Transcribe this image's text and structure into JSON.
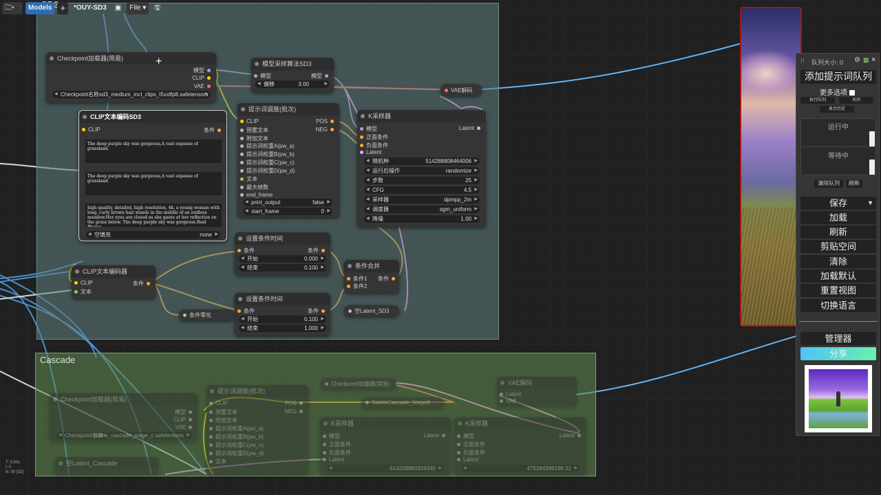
{
  "topbar": {
    "folder_icon": "folder-icon",
    "models_label": "Models",
    "add_label": "+",
    "title": "*OUY-SD3",
    "file_label": "File"
  },
  "groups": {
    "sd3": "SD3",
    "cascade": "Cascade"
  },
  "nodes": {
    "ckpt": {
      "title": "Checkpoint加载器(简易)",
      "out1": "模型",
      "out2": "CLIP",
      "out3": "VAE",
      "w_key": "Checkpoint名称",
      "w_val": "sd3_medium_incl_clips_t5xxlfp8.safetensors"
    },
    "sampling": {
      "title": "模型采样算法SD3",
      "in1": "模型",
      "out1": "模型",
      "w_key": "偏移",
      "w_val": "3.00"
    },
    "vae_decode": {
      "title": "VAE解码"
    },
    "clip_sd3": {
      "title": "CLIP文本编码SD3",
      "in1": "CLIP",
      "out1": "条件",
      "t1": "The deep purple sky was gorgeous,A vast expanse of grassland.",
      "t2": "The deep purple sky was gorgeous,A vast expanse of grassland.",
      "t3": "high quality, detailed, high resolution, 4k,\na young woman with long, curly brown hair stands in the middle of an endless meadow.Her eyes are closed as she gazes at her reflection on the grass below. The deep purple sky was gorgeous.Real Photos.",
      "w_key": "空填充",
      "w_val": "none"
    },
    "prompt_batch": {
      "title": "提示词调度(批次)",
      "in1": "CLIP",
      "in2": "预置文本",
      "in3": "附加文本",
      "in4": "提示词权重A(pw_a)",
      "in5": "提示词权重B(pw_b)",
      "in6": "提示词权重C(pw_c)",
      "in7": "提示词权重D(pw_d)",
      "in8": "文本",
      "in9": "最大帧数",
      "in10": "end_frame",
      "out1": "POS",
      "out2": "NEG",
      "w1_key": "print_output",
      "w1_val": "false",
      "w2_key": "start_frame",
      "w2_val": "0"
    },
    "ksampler": {
      "title": "K采样器",
      "in1": "模型",
      "in2": "正面条件",
      "in3": "负面条件",
      "in4": "Latent",
      "out1": "Latent",
      "w": [
        [
          "随机种",
          "514288808464006"
        ],
        [
          "运行后操作",
          "randomize"
        ],
        [
          "步数",
          "25"
        ],
        [
          "CFG",
          "4.5"
        ],
        [
          "采样器",
          "dpmpp_2m"
        ],
        [
          "调度器",
          "sgm_uniform"
        ],
        [
          "降噪",
          "1.00"
        ]
      ]
    },
    "clip_enc": {
      "title": "CLIP文本编码器",
      "in1": "CLIP",
      "in2": "文本",
      "out1": "条件"
    },
    "cond_time1": {
      "title": "设置条件时间",
      "in1": "条件",
      "out1": "条件",
      "w1_key": "开始",
      "w1_val": "0.000",
      "w2_key": "结束",
      "w2_val": "0.100"
    },
    "cond_time2": {
      "title": "设置条件时间",
      "in1": "条件",
      "out1": "条件",
      "w1_key": "开始",
      "w1_val": "0.100",
      "w2_key": "结束",
      "w2_val": "1.000"
    },
    "cond_combine": {
      "title": "条件合并",
      "in1": "条件1",
      "in2": "条件2",
      "out1": "条件"
    },
    "cond_zero": {
      "title": "条件零化"
    },
    "empty_latent": {
      "title": "空Latent_SD3"
    }
  },
  "cascade_nodes": {
    "ckpt": {
      "title": "Checkpoint加载器(简易)",
      "o1": "模型",
      "o2": "CLIP",
      "o3": "VAE",
      "w_key": "Checkpoint名称",
      "w_val": "stable_cascade_stage_c.safetensors"
    },
    "prompt": {
      "title": "提示词调度(批次)",
      "i1": "CLIP",
      "i2": "预置文本",
      "i3": "附加文本",
      "i4": "提示词权重A(pw_a)",
      "i5": "提示词权重B(pw_b)",
      "i6": "提示词权重C(pw_c)",
      "i7": "提示词权重D(pw_d)",
      "i8": "文本",
      "o1": "POS",
      "o2": "NEG"
    },
    "ckpt2": {
      "title": "Checkpoint加载器(简易)"
    },
    "stage_b": {
      "title": "StableCascade_StageB"
    },
    "vae": {
      "title": "VAE解码",
      "i1": "Latent",
      "i2": "VAE"
    },
    "ks1": {
      "title": "K采样器",
      "i1": "模型",
      "i2": "正面条件",
      "i3": "负面条件",
      "i4": "Latent",
      "o1": "Latent",
      "seed": "614258880359345"
    },
    "ks2": {
      "title": "K采样器",
      "i1": "模型",
      "i2": "正面条件",
      "i3": "负面条件",
      "i4": "Latent",
      "o1": "Latent",
      "seed": "475264399196 21"
    },
    "latent": {
      "title": "空Latent_Cascade"
    }
  },
  "panel": {
    "queue_size": "队列大小: 0",
    "add_queue": "添加提示词队列",
    "more_options": "更多选项",
    "exec_queue": "执行队列",
    "close": "关闭",
    "history": "显示历史",
    "running": "运行中",
    "pending": "等待中",
    "clear_queue": "清除队列",
    "refresh_small": "刷新",
    "buttons": [
      "保存",
      "加载",
      "刷新",
      "剪贴空间",
      "清除",
      "加载默认",
      "重置视图",
      "切换语言"
    ],
    "manager": "管理器",
    "share": "分享"
  },
  "stats": {
    "t": "T: 0.00s",
    "i": "I: 0",
    "n": "N: 00 [32]"
  },
  "colors": {
    "clip": "#ffd500",
    "model": "#b39ddb",
    "vae": "#ff6e6e",
    "cond": "#ffa931",
    "latent": "#ff9cf9",
    "image": "#64b5f6",
    "share_start": "#4fc3f7",
    "share_end": "#69f0ae"
  }
}
